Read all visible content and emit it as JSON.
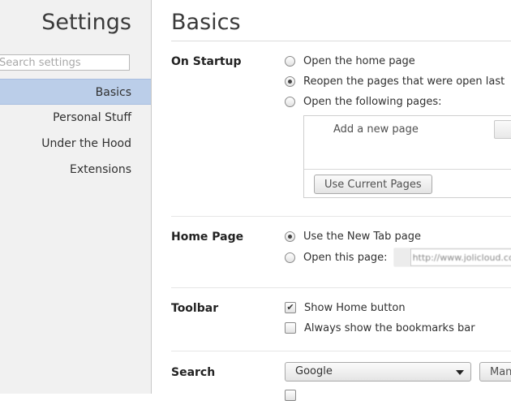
{
  "sidebar": {
    "title": "Settings",
    "search_placeholder": "Search settings",
    "items": [
      {
        "label": "Basics",
        "active": true
      },
      {
        "label": "Personal Stuff",
        "active": false
      },
      {
        "label": "Under the Hood",
        "active": false
      },
      {
        "label": "Extensions",
        "active": false
      }
    ]
  },
  "main": {
    "title": "Basics",
    "startup": {
      "label": "On Startup",
      "options": [
        {
          "label": "Open the home page",
          "checked": false
        },
        {
          "label": "Reopen the pages that were open last",
          "checked": true
        },
        {
          "label": "Open the following pages:",
          "checked": false
        }
      ],
      "add_page_label": "Add a new page",
      "use_current_button": "Use Current Pages"
    },
    "home_page": {
      "label": "Home Page",
      "options": [
        {
          "label": "Use the New Tab page",
          "checked": true
        },
        {
          "label": "Open this page:",
          "checked": false
        }
      ],
      "url_value": "http://www.jolicloud.com"
    },
    "toolbar": {
      "label": "Toolbar",
      "options": [
        {
          "label": "Show Home button",
          "checked": true
        },
        {
          "label": "Always show the bookmarks bar",
          "checked": false
        }
      ]
    },
    "search": {
      "label": "Search",
      "engine": "Google",
      "manage_button": "Man"
    }
  },
  "colors": {
    "sidebar_bg": "#f1f1f1",
    "active_item": "#bbcee9",
    "text": "#303030"
  }
}
